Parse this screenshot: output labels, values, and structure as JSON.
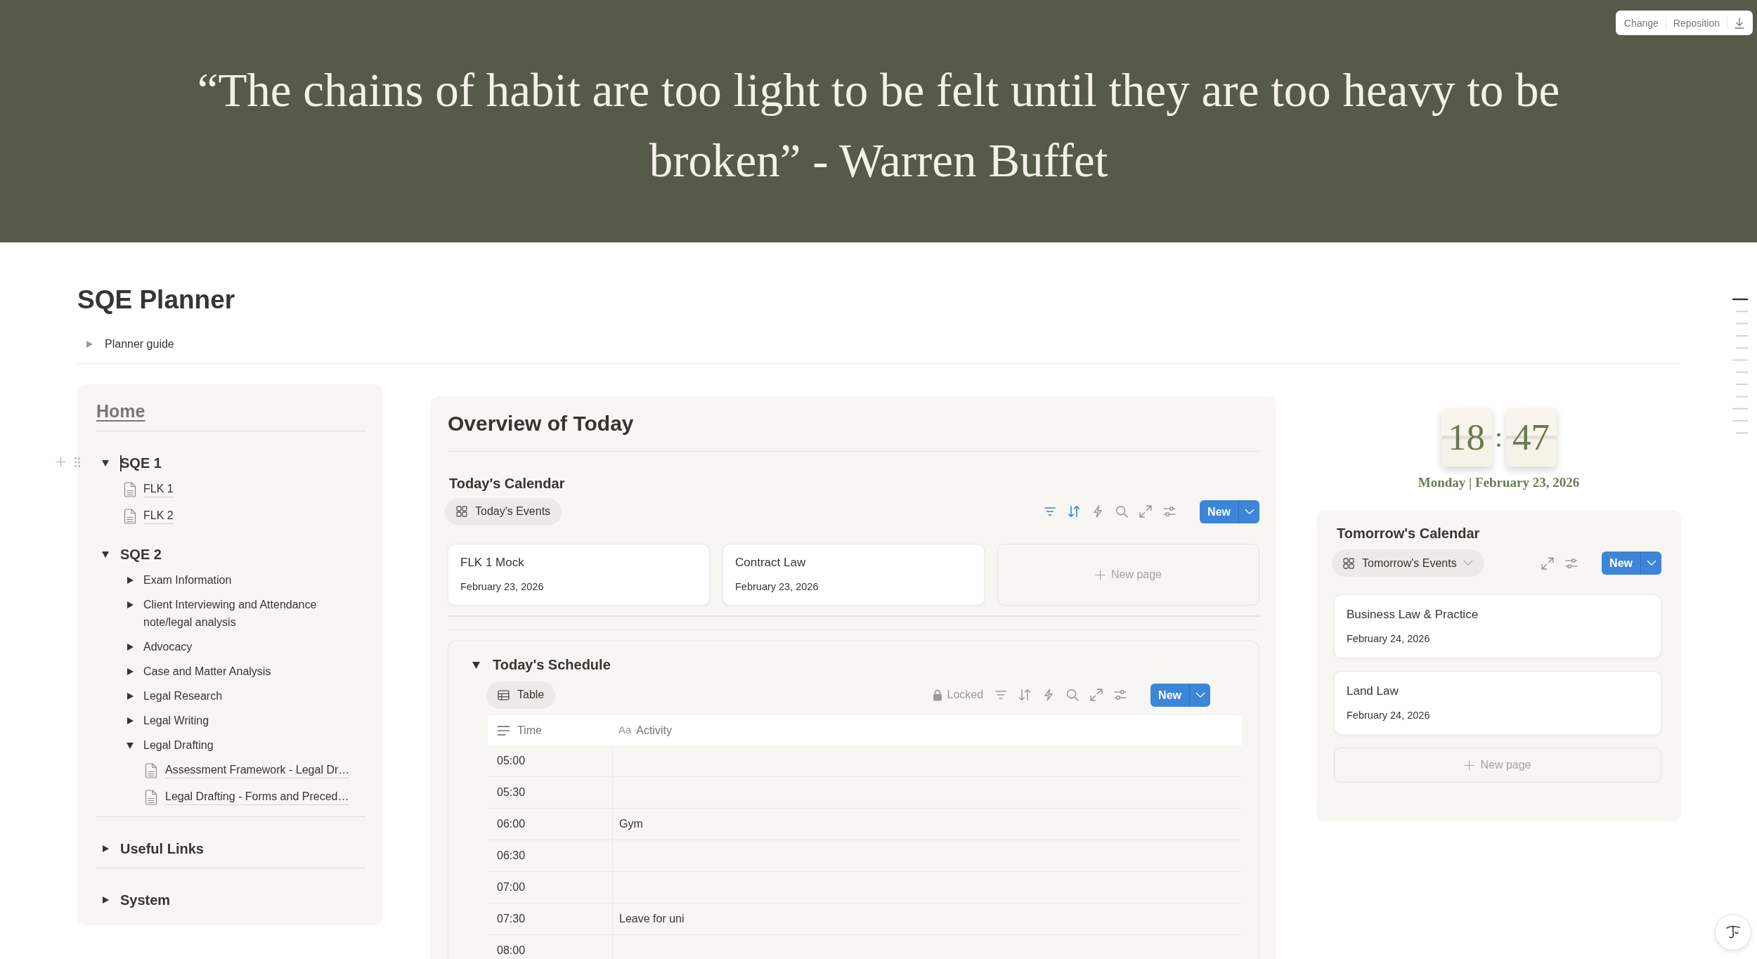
{
  "cover": {
    "quote": "“The chains of habit are too light to be felt until they are too heavy to be broken” - Warren Buffet",
    "buttons": [
      "Change",
      "Reposition"
    ]
  },
  "page": {
    "title": "SQE Planner",
    "guide": {
      "label": "Planner guide",
      "expanded": false
    }
  },
  "sidebar": [
    {
      "kind": "link",
      "label": "Home"
    },
    {
      "kind": "divider"
    },
    {
      "kind": "heading",
      "label": "SQE 1",
      "expanded": true,
      "focused": true,
      "children": [
        {
          "kind": "page",
          "label": "FLK 1"
        },
        {
          "kind": "page",
          "label": "FLK 2"
        }
      ]
    },
    {
      "kind": "heading",
      "label": "SQE 2",
      "expanded": true,
      "focused": false,
      "children": [
        {
          "kind": "toggle",
          "label": "Exam Information",
          "expanded": false
        },
        {
          "kind": "toggle",
          "label": "Client Interviewing and Attendance note/legal analysis",
          "expanded": false
        },
        {
          "kind": "toggle",
          "label": "Advocacy",
          "expanded": false
        },
        {
          "kind": "toggle",
          "label": "Case and Matter Analysis",
          "expanded": false
        },
        {
          "kind": "toggle",
          "label": "Legal Research",
          "expanded": false
        },
        {
          "kind": "toggle",
          "label": "Legal Writing",
          "expanded": false
        },
        {
          "kind": "toggle",
          "label": "Legal Drafting",
          "expanded": true,
          "children": [
            {
              "kind": "page",
              "label": "Assessment Framework - Legal Dr…"
            },
            {
              "kind": "page",
              "label": "Legal Drafting - Forms and Preced…"
            }
          ]
        }
      ]
    },
    {
      "kind": "divider"
    },
    {
      "kind": "heading",
      "label": "Useful Links",
      "expanded": false,
      "focused": false
    },
    {
      "kind": "divider"
    },
    {
      "kind": "heading",
      "label": "System",
      "expanded": false,
      "focused": false
    }
  ],
  "overview": {
    "title": "Overview of Today",
    "calendar": {
      "title": "Today's Calendar",
      "view": {
        "kind": "gallery",
        "label": "Today's Events",
        "selected": true
      },
      "tools": [
        {
          "kind": "filter",
          "active": true
        },
        {
          "kind": "sort",
          "active": true
        },
        {
          "kind": "automation"
        },
        {
          "kind": "search"
        },
        {
          "kind": "expand"
        },
        {
          "kind": "settings"
        }
      ],
      "new_button": "New",
      "cards": [
        {
          "title": "FLK 1 Mock",
          "date": "February 23, 2026"
        },
        {
          "title": "Contract Law",
          "date": "February 23, 2026"
        }
      ],
      "new_page": "New page"
    },
    "schedule": {
      "title": "Today's Schedule",
      "expanded": true,
      "view": {
        "kind": "table",
        "label": "Table",
        "selected": true
      },
      "tools": [
        {
          "kind": "lock",
          "label": "Locked"
        },
        {
          "kind": "filter",
          "active": false
        },
        {
          "kind": "sort",
          "active": false
        },
        {
          "kind": "automation"
        },
        {
          "kind": "search"
        },
        {
          "kind": "expand"
        },
        {
          "kind": "settings"
        }
      ],
      "new_button": "New",
      "columns": [
        {
          "kind": "text",
          "label": "Time"
        },
        {
          "kind": "title",
          "label": "Activity",
          "glyph": "Aa"
        }
      ],
      "rows": [
        {
          "time": "05:00"
        },
        {
          "time": "05:30"
        },
        {
          "time": "06:00",
          "activity": "Gym"
        },
        {
          "time": "06:30"
        },
        {
          "time": "07:00"
        },
        {
          "time": "07:30",
          "activity": "Leave for uni"
        },
        {
          "time": "08:00"
        }
      ]
    }
  },
  "clock": {
    "hours": "18",
    "separator": ":",
    "minutes": "47",
    "date": "Monday | February 23, 2026"
  },
  "tomorrow": {
    "title": "Tomorrow's Calendar",
    "view": {
      "kind": "gallery",
      "label": "Tomorrow's Events",
      "selected": true,
      "dropdown": true
    },
    "tools": [
      {
        "kind": "expand"
      },
      {
        "kind": "settings"
      }
    ],
    "new_button": "New",
    "cards": [
      {
        "title": "Business Law & Practice",
        "date": "February 24, 2026"
      },
      {
        "title": "Land Law",
        "date": "February 24, 2026"
      }
    ],
    "new_page": "New page"
  }
}
